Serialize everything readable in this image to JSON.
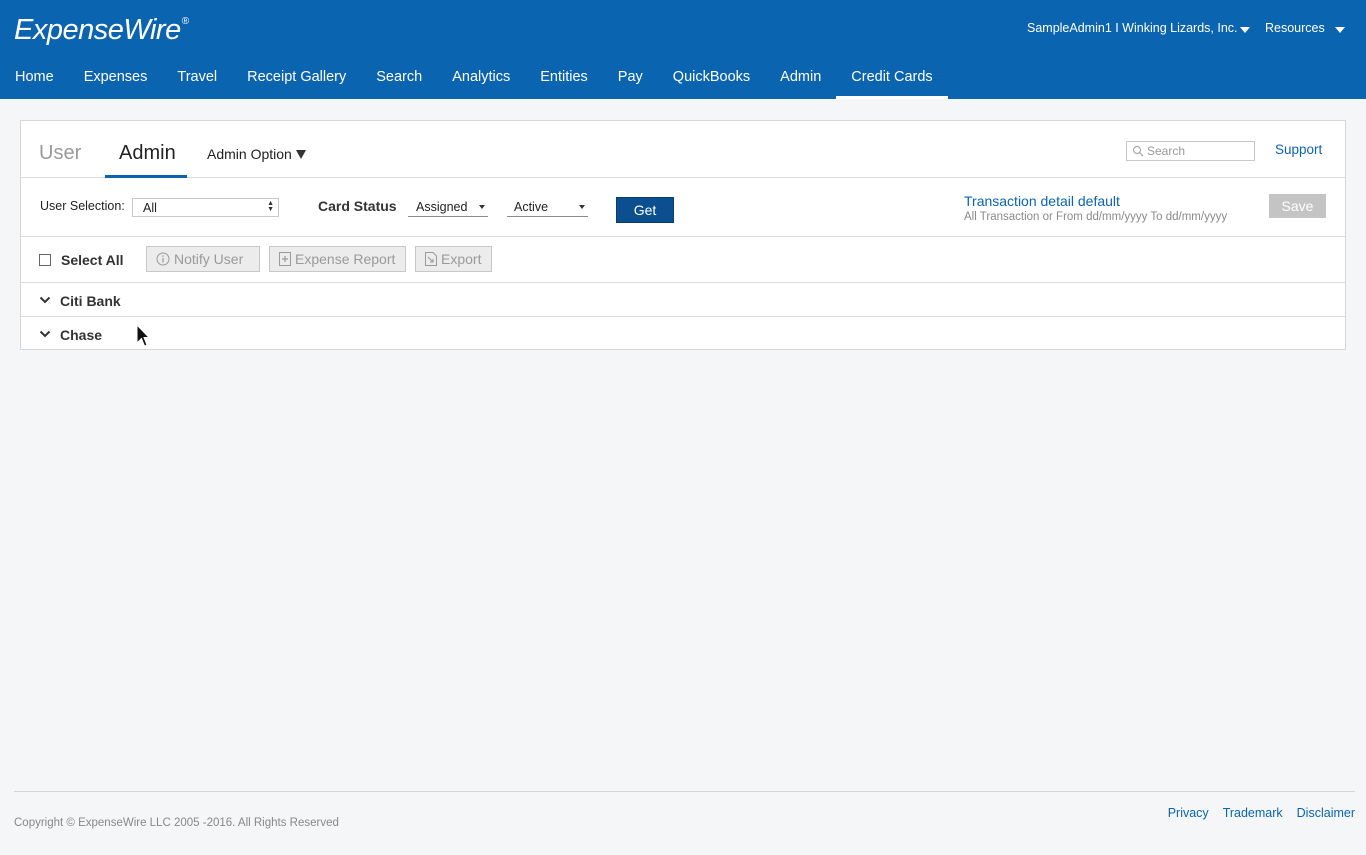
{
  "header": {
    "logo": "ExpenseWire",
    "logo_mark": "®",
    "account": "SampleAdmin1 I Winking Lizards, Inc.",
    "resources": "Resources"
  },
  "nav": [
    {
      "label": "Home"
    },
    {
      "label": "Expenses"
    },
    {
      "label": "Travel"
    },
    {
      "label": "Receipt Gallery"
    },
    {
      "label": "Search"
    },
    {
      "label": "Analytics"
    },
    {
      "label": "Entities"
    },
    {
      "label": "Pay"
    },
    {
      "label": "QuickBooks"
    },
    {
      "label": "Admin"
    },
    {
      "label": "Credit Cards",
      "active": true
    }
  ],
  "tabs": {
    "user": "User",
    "admin": "Admin",
    "admin_option": "Admin Option"
  },
  "search": {
    "placeholder": "Search"
  },
  "support": "Support",
  "filters": {
    "user_selection_label": "User Selection:",
    "user_selection_value": "All",
    "card_status_label": "Card Status",
    "card_status_value": "Assigned",
    "activity_value": "Active",
    "get_label": "Get",
    "transaction_default": "Transaction detail default",
    "transaction_hint": "All Transaction or From dd/mm/yyyy To dd/mm/yyyy",
    "save_label": "Save"
  },
  "actions": {
    "select_all": "Select All",
    "notify_user": "Notify User",
    "expense_report": "Expense Report",
    "export": "Export"
  },
  "groups": [
    {
      "label": "Citi Bank"
    },
    {
      "label": "Chase"
    }
  ],
  "footer": {
    "copyright": "Copyright © ExpenseWire LLC 2005 -2016. All Rights Reserved",
    "links": [
      "Privacy",
      "Trademark",
      "Disclaimer"
    ]
  },
  "colors": {
    "brand": "#0b64b0",
    "get_button": "#0b4f8e",
    "save_disabled": "#c4c4c4"
  }
}
